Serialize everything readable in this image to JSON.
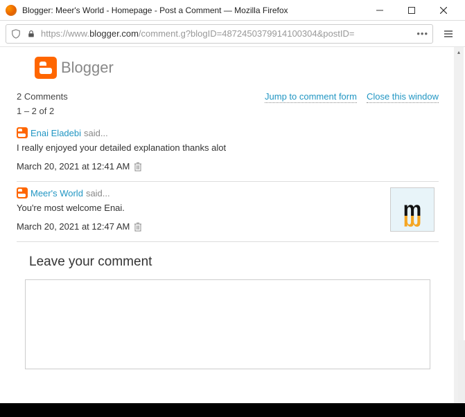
{
  "window": {
    "title": "Blogger: Meer's World - Homepage - Post a Comment — Mozilla Firefox"
  },
  "url": {
    "proto": "https://www.",
    "domain": "blogger.",
    "tld": "com",
    "path": "/comment.g?blogID=4872450379914100304&postID="
  },
  "header": {
    "brand": "Blogger"
  },
  "links": {
    "jump": "Jump to comment form",
    "close": "Close this window"
  },
  "counts": {
    "total": "2 Comments",
    "range": "1 – 2 of 2"
  },
  "said_suffix": " said...",
  "comments": [
    {
      "author": "Enai Eladebi",
      "body": "I really enjoyed your detailed explanation thanks alot",
      "date": "March 20, 2021 at 12:41 AM"
    },
    {
      "author": "Meer's World",
      "body": "You're most welcome Enai.",
      "date": "March 20, 2021 at 12:47 AM"
    }
  ],
  "leave_heading": "Leave your comment",
  "avatar_text": "m"
}
